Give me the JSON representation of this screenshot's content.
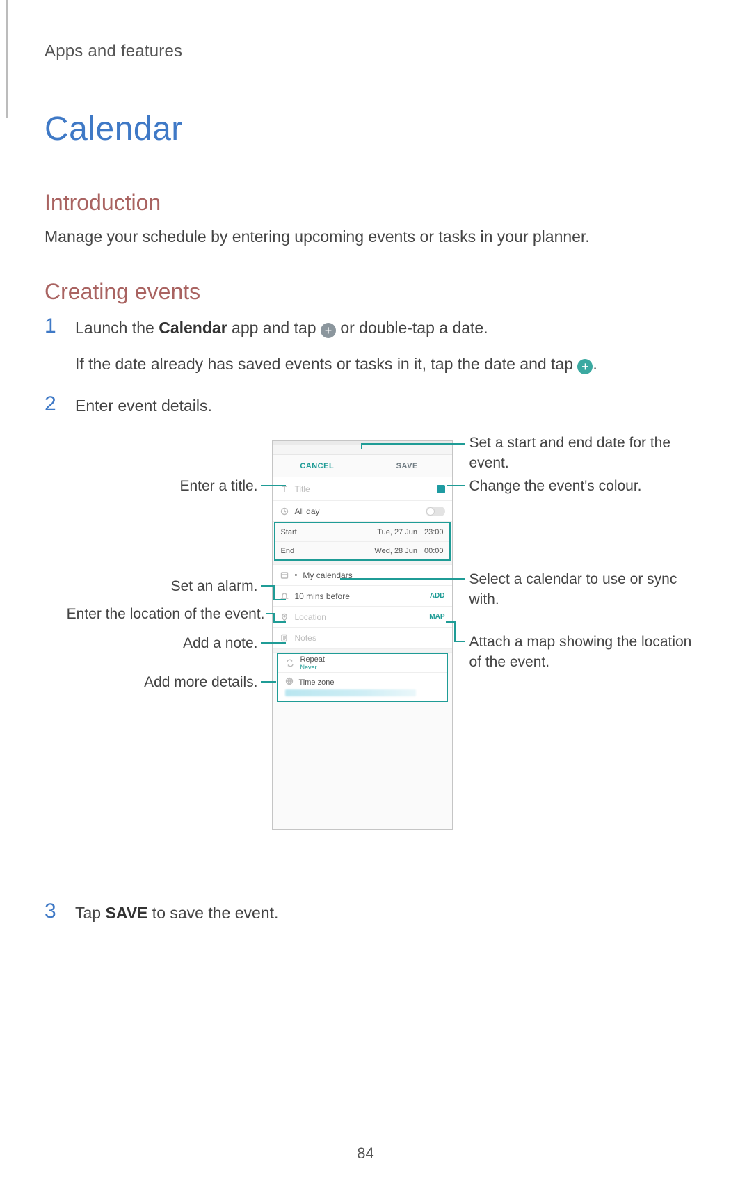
{
  "header": {
    "section": "Apps and features"
  },
  "title": "Calendar",
  "intro": {
    "heading": "Introduction",
    "body": "Manage your schedule by entering upcoming events or tasks in your planner."
  },
  "creating": {
    "heading": "Creating events"
  },
  "steps": {
    "s1": {
      "num": "1",
      "part1": "Launch the ",
      "bold": "Calendar",
      "part2": " app and tap ",
      "part3": " or double-tap a date.",
      "line2_a": "If the date already has saved events or tasks in it, tap the date and tap ",
      "line2_b": "."
    },
    "s2": {
      "num": "2",
      "text": "Enter event details."
    },
    "s3": {
      "num": "3",
      "part1": "Tap ",
      "bold": "SAVE",
      "part2": " to save the event."
    }
  },
  "phone": {
    "cancel": "CANCEL",
    "save": "SAVE",
    "title_placeholder": "Title",
    "all_day": "All day",
    "start_label": "Start",
    "start_date": "Tue, 27 Jun",
    "start_time": "23:00",
    "end_label": "End",
    "end_date": "Wed, 28 Jun",
    "end_time": "00:00",
    "my_calendars": "My calendars",
    "reminder": "10 mins before",
    "add": "ADD",
    "location_placeholder": "Location",
    "map": "MAP",
    "notes_placeholder": "Notes",
    "repeat": "Repeat",
    "repeat_value": "Never",
    "timezone": "Time zone"
  },
  "callouts": {
    "enter_title": "Enter a title.",
    "set_alarm": "Set an alarm.",
    "enter_location": "Enter the location of the event.",
    "add_note": "Add a note.",
    "add_more": "Add more details.",
    "set_dates": "Set a start and end date for the event.",
    "change_colour": "Change the event's colour.",
    "select_calendar": "Select a calendar to use or sync with.",
    "attach_map": "Attach a map showing the location of the event."
  },
  "page_number": "84",
  "chart_data": null
}
